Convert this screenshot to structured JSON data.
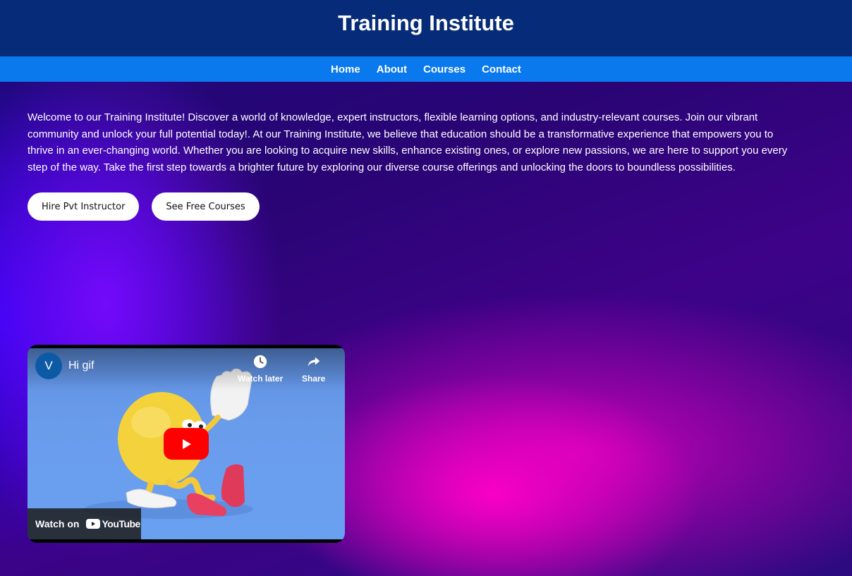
{
  "header": {
    "title": "Training Institute"
  },
  "nav": {
    "items": [
      {
        "label": "Home"
      },
      {
        "label": "About"
      },
      {
        "label": "Courses"
      },
      {
        "label": "Contact"
      }
    ]
  },
  "main": {
    "intro": "Welcome to our Training Institute! Discover a world of knowledge, expert instructors, flexible learning options, and industry-relevant courses. Join our vibrant community and unlock your full potential today!. At our Training Institute, we believe that education should be a transformative experience that empowers you to thrive in an ever-changing world. Whether you are looking to acquire new skills, enhance existing ones, or explore new passions, we are here to support you every step of the way. Take the first step towards a brighter future by exploring our diverse course offerings and unlocking the doors to boundless possibilities.",
    "buttons": {
      "hire": "Hire Pvt Instructor",
      "free_courses": "See Free Courses"
    }
  },
  "video": {
    "channel_initial": "V",
    "title": "Hi gif",
    "watch_later": "Watch later",
    "share": "Share",
    "watch_on": "Watch on",
    "platform": "YouTube",
    "icons": {
      "play": "play-icon",
      "clock": "clock-icon",
      "share": "share-icon"
    }
  },
  "colors": {
    "header_bg": "#062b78",
    "nav_bg": "#0a79ee",
    "play_red": "#ff0000"
  }
}
